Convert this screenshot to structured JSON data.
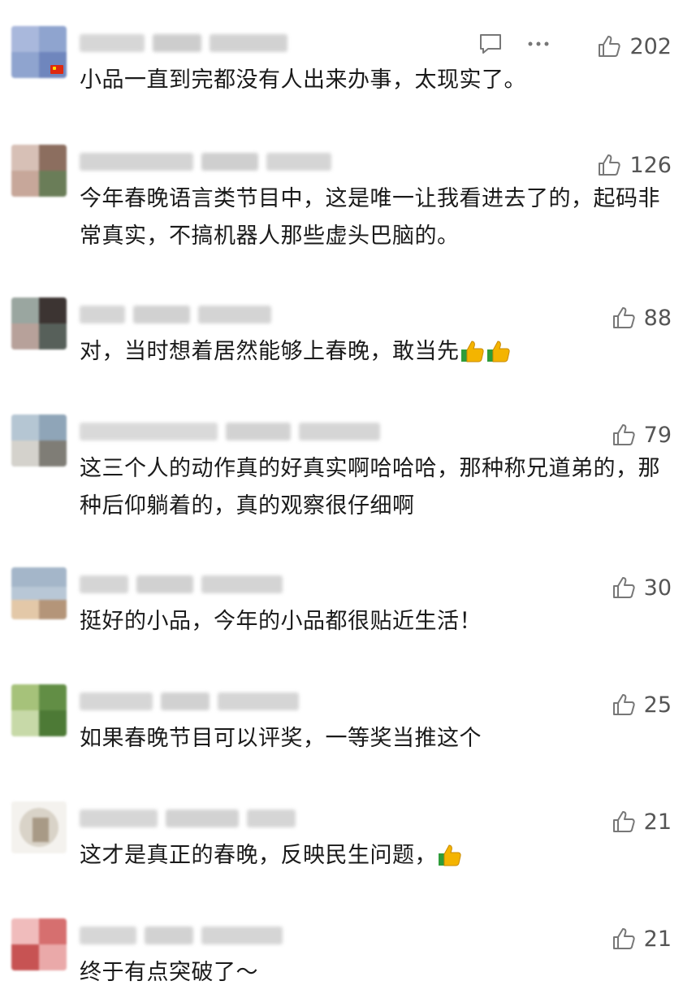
{
  "comments": [
    {
      "text": "小品一直到完都没有人出来办事，太现实了。",
      "likes": "202",
      "emojis": 0
    },
    {
      "text": "今年春晚语言类节目中，这是唯一让我看进去了的，起码非常真实，不搞机器人那些虚头巴脑的。",
      "likes": "126",
      "emojis": 0
    },
    {
      "text": "对，当时想着居然能够上春晚，敢当先",
      "likes": "88",
      "emojis": 2
    },
    {
      "text": "这三个人的动作真的好真实啊哈哈哈，那种称兄道弟的，那种后仰躺着的，真的观察很仔细啊",
      "likes": "79",
      "emojis": 0
    },
    {
      "text": "挺好的小品，今年的小品都很贴近生活！",
      "likes": "30",
      "emojis": 0
    },
    {
      "text": "如果春晚节目可以评奖，一等奖当推这个",
      "likes": "25",
      "emojis": 0
    },
    {
      "text": "这才是真正的春晚，反映民生问题，",
      "likes": "21",
      "emojis": 1
    },
    {
      "text": "终于有点突破了～",
      "likes": "21",
      "emojis": 0
    }
  ],
  "icons": {
    "reply": "comment-bubble-icon",
    "more": "more-dots-icon",
    "like": "thumbs-up-icon",
    "emoji": "thumbs-up-emoji-icon"
  },
  "colors": {
    "text": "#1a1a1a",
    "count": "#555555",
    "icon": "#777777"
  }
}
